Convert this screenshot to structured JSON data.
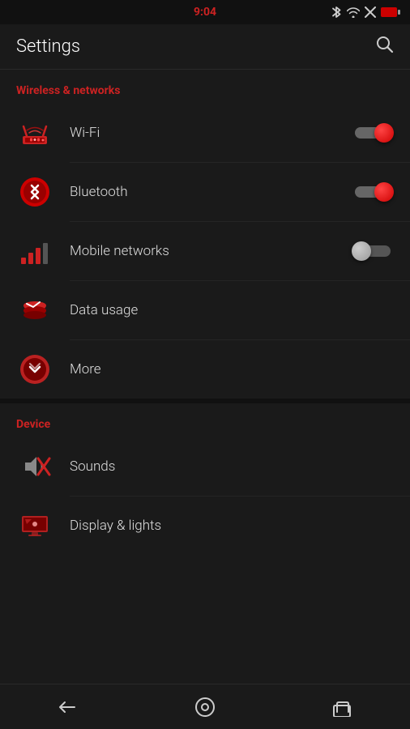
{
  "status_bar": {
    "time": "9:04",
    "bluetooth_icon": "B",
    "wifi_icon": "W",
    "airplane_icon": "X"
  },
  "toolbar": {
    "title": "Settings",
    "search_label": "Search"
  },
  "sections": [
    {
      "id": "wireless",
      "header": "Wireless & networks",
      "items": [
        {
          "id": "wifi",
          "label": "Wi-Fi",
          "has_toggle": true,
          "toggle_on": true,
          "icon": "wifi"
        },
        {
          "id": "bluetooth",
          "label": "Bluetooth",
          "has_toggle": true,
          "toggle_on": true,
          "icon": "bluetooth"
        },
        {
          "id": "mobile_networks",
          "label": "Mobile networks",
          "has_toggle": true,
          "toggle_on": false,
          "icon": "signal"
        },
        {
          "id": "data_usage",
          "label": "Data usage",
          "has_toggle": false,
          "icon": "data"
        },
        {
          "id": "more",
          "label": "More",
          "has_toggle": false,
          "icon": "more"
        }
      ]
    },
    {
      "id": "device",
      "header": "Device",
      "items": [
        {
          "id": "sounds",
          "label": "Sounds",
          "has_toggle": false,
          "icon": "sounds"
        },
        {
          "id": "display_lights",
          "label": "Display & lights",
          "has_toggle": false,
          "icon": "display"
        }
      ]
    }
  ],
  "nav_bar": {
    "back_label": "Back",
    "home_label": "Home",
    "recents_label": "Recents"
  },
  "colors": {
    "accent": "#cc2222",
    "toggle_on": "#cc0000",
    "background": "#1a1a1a"
  }
}
